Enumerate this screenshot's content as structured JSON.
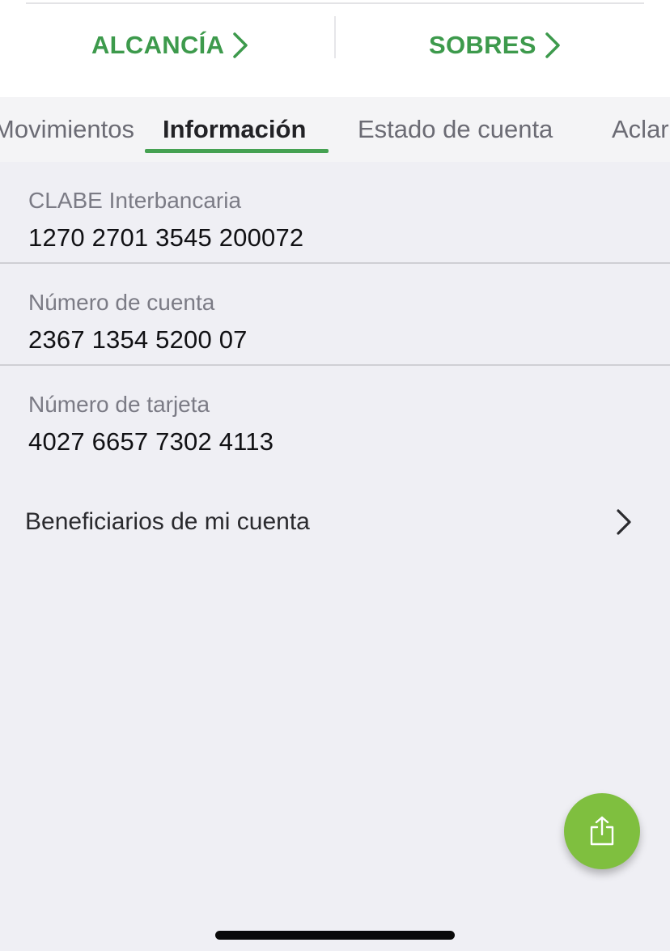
{
  "quick_links": {
    "left_label": "ALCANCÍA",
    "right_label": "SOBRES",
    "chevron_icon": "chevron-right-icon"
  },
  "tabs": [
    {
      "label": "Movimientos"
    },
    {
      "label": "Información",
      "active": true
    },
    {
      "label": "Estado de cuenta"
    },
    {
      "label": "Aclaraciones"
    }
  ],
  "info": {
    "clabe": {
      "label": "CLABE Interbancaria",
      "value": "1270 2701 3545 200072"
    },
    "cuenta": {
      "label": "Número de cuenta",
      "value": "2367 1354 5200 07"
    },
    "tarjeta": {
      "label": "Número de tarjeta",
      "value": "4027 6657 7302 4113"
    }
  },
  "beneficiarios": {
    "label": "Beneficiarios de mi cuenta",
    "icon": "chevron-right-icon"
  },
  "fab": {
    "icon": "share-icon"
  },
  "colors": {
    "accent_green": "#3d9a4c",
    "tab_underline": "#45a152",
    "fab_green": "#7fbf3f",
    "background": "#efeff4"
  }
}
